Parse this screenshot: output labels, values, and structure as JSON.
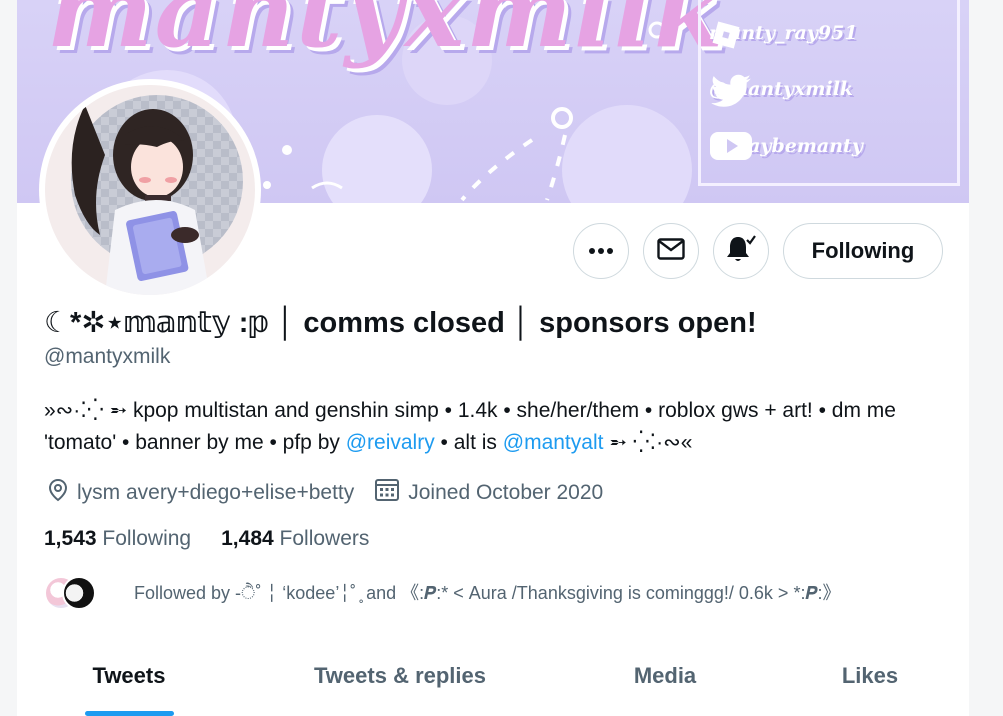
{
  "banner": {
    "title": "mantyxmilk",
    "socials": [
      {
        "label": "manty_ray951",
        "icon": "roblox-icon"
      },
      {
        "label": "@mantyxmilk",
        "icon": "twitter-bird-icon"
      },
      {
        "label": "@maybemanty",
        "icon": "youtube-icon"
      }
    ]
  },
  "profile": {
    "display_name": "☾*✲⋆𝕞𝕒𝕟𝕥𝕪 :𝕡 │ comms closed │ sponsors open!",
    "handle": "@mantyxmilk",
    "bio_parts": {
      "p1": "»∾·⁚⁛ ➵ kpop multistan and genshin simp • 1.4k • she/her/them • roblox gws + art! • dm me 'tomato' • banner by me • pfp by ",
      "link1": "@reivalry",
      "p2": " • alt is ",
      "link2": "@mantyalt",
      "p3": " ➵ ⁛⁚·∾«"
    },
    "location": "lysm avery+diego+elise+betty",
    "joined": "Joined October 2020",
    "following_count": "1,543",
    "following_label": "Following",
    "followers_count": "1,484",
    "followers_label": "Followers",
    "followed_by": "Followed by -ੈ˚ ╎ ‘kodee’╎˚ ̥ and 《:𝜬:* < Aura /Thanksgiving is cominggg!/ 0.6k > *:𝜬:》"
  },
  "actions": {
    "more_icon": "more-icon",
    "message_icon": "mail-icon",
    "notify_icon": "bell-subscribed-icon",
    "follow_label": "Following"
  },
  "tabs": [
    {
      "label": "Tweets",
      "active": true
    },
    {
      "label": "Tweets & replies",
      "active": false
    },
    {
      "label": "Media",
      "active": false
    },
    {
      "label": "Likes",
      "active": false
    }
  ],
  "colors": {
    "accent": "#1d9bf0",
    "banner": "#d8d2f7",
    "banner_title": "#e6a3e3",
    "secondary_text": "#536471"
  }
}
